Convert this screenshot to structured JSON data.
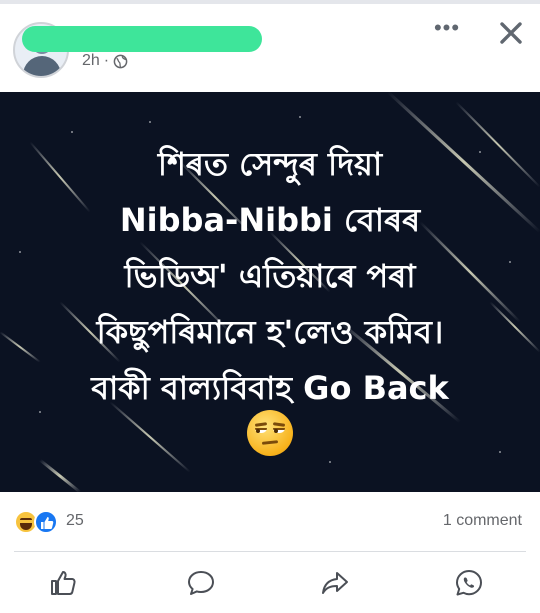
{
  "post": {
    "author_redacted": true,
    "time": "2h",
    "separator": "·",
    "privacy_icon": "globe-icon",
    "menu_icon": "more-icon",
    "close_icon": "close-icon"
  },
  "image": {
    "background_color": "#0b1222",
    "lines": [
      "শিৰত সেন্দুৰ দিয়া",
      "Nibba-Nibbi বোৰৰ",
      "ভিডিঅ' এতিয়াৰে পৰা",
      "কিছুপৰিমানে হ'লেও কমিব।",
      "বাকী বাল্যবিবাহ Go Back"
    ],
    "emoji": "unamused-face-emoji"
  },
  "reactions": {
    "icons": [
      "haha-icon",
      "like-icon"
    ],
    "count": "25",
    "comments": "1 comment"
  },
  "actions": {
    "like_icon": "like-icon",
    "comment_icon": "comment-icon",
    "share_icon": "share-icon",
    "whatsapp_icon": "whatsapp-icon"
  },
  "colors": {
    "accent": "#1877f2",
    "muted_text": "#65676b",
    "redaction": "#3ee59a"
  }
}
